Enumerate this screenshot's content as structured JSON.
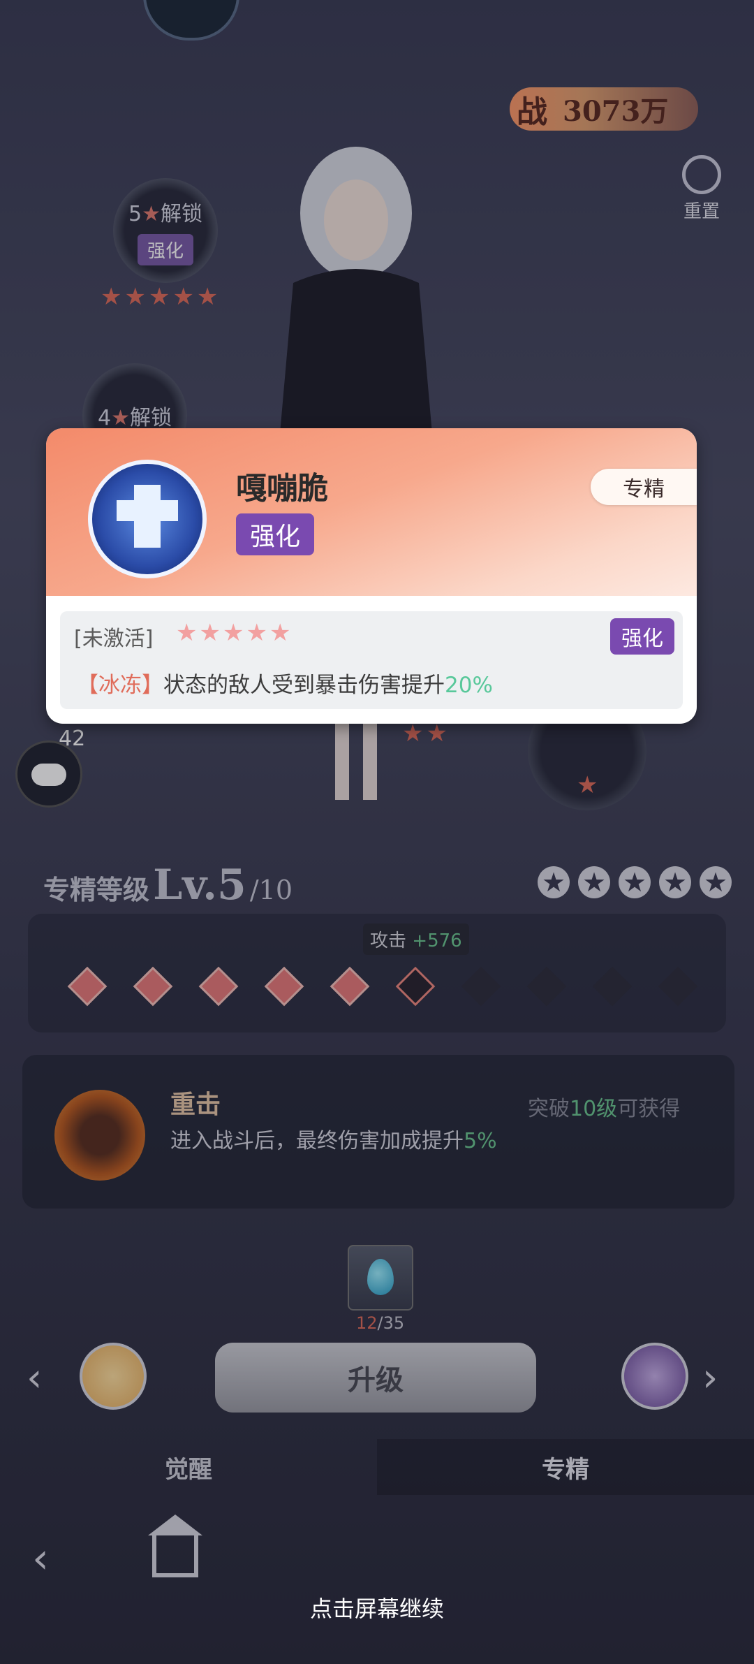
{
  "power": {
    "label": "战",
    "value": "3073万"
  },
  "reset_label": "重置",
  "nodes": [
    {
      "lock": "5",
      "lock_suffix": "解锁",
      "tag": "强化"
    },
    {
      "lock": "4",
      "lock_suffix": "解锁"
    }
  ],
  "chat_count": "42",
  "popup": {
    "skill_name": "嘎嘣脆",
    "skill_tag": "强化",
    "spec_tag": "专精",
    "inactive": "[未激活]",
    "body_tag": "强化",
    "effect_keyword": "【冰冻】",
    "effect_text": "状态的敌人受到暴击伤害提升",
    "effect_value": "20%"
  },
  "spec": {
    "label": "专精等级",
    "level": "Lv.5",
    "max": "/10"
  },
  "attack_bonus": {
    "label": "攻击",
    "value": "+576"
  },
  "bonus": {
    "name": "重击",
    "desc": "进入战斗后，最终伤害加成提升",
    "desc_value": "5%",
    "cond_prefix": "突破",
    "cond_value": "10级",
    "cond_suffix": "可获得"
  },
  "material": {
    "have": "12",
    "need": "/35"
  },
  "upgrade_label": "升级",
  "tabs": {
    "left": "觉醒",
    "right": "专精"
  },
  "continue_text": "点击屏幕继续",
  "colors": {
    "accent_green": "#6cc890",
    "accent_red": "#e06c5a",
    "purple_tag": "#7a4ab0"
  }
}
